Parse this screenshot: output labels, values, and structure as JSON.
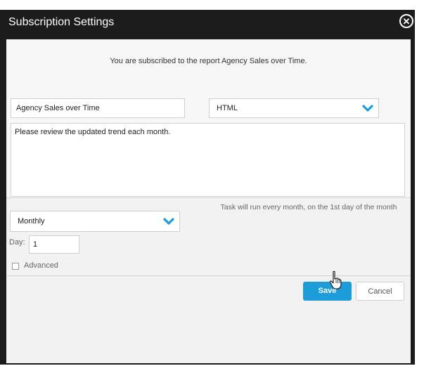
{
  "dialog": {
    "title": "Subscription Settings",
    "close_glyph": "✕"
  },
  "intro_text": "You are subscribed to the report Agency Sales over Time.",
  "subscription_name": {
    "value": "Agency Sales over Time"
  },
  "format_select": {
    "value": "HTML"
  },
  "message": {
    "value": "Please review the updated trend each month."
  },
  "frequency_select": {
    "value": "Monthly"
  },
  "schedule_note": "Task will run every month, on the 1st day of the month",
  "day": {
    "label": "Day:",
    "value": "1"
  },
  "advanced": {
    "label": "Advanced",
    "checked": false
  },
  "buttons": {
    "save": "Save",
    "cancel": "Cancel"
  },
  "colors": {
    "accent": "#1c9cd8",
    "dialog_frame": "#1c1c1c"
  },
  "icons": [
    "close-icon",
    "chevron-down-icon",
    "hand-cursor-icon",
    "checkbox"
  ]
}
